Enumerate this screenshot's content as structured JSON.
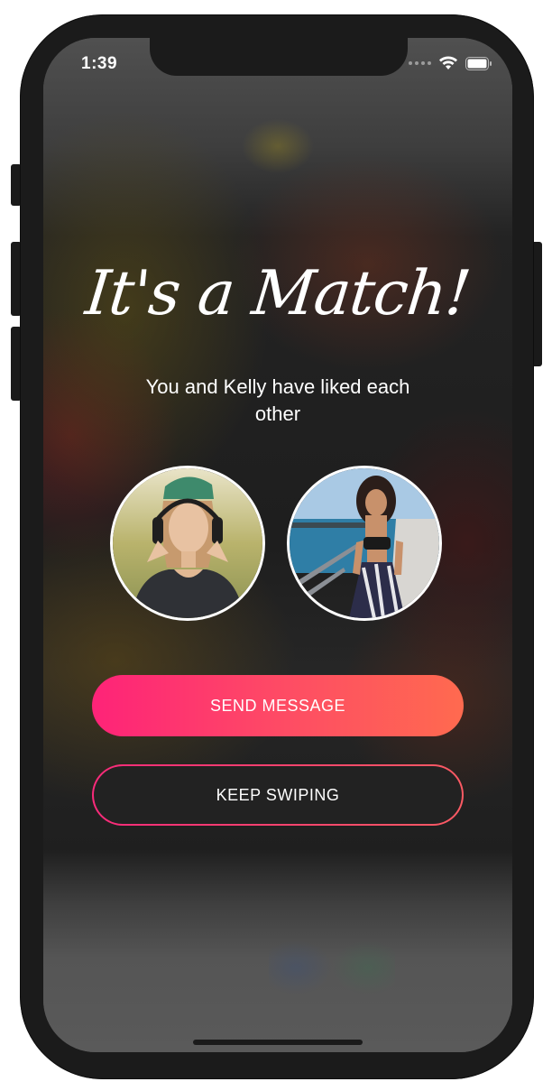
{
  "status_bar": {
    "time": "1:39"
  },
  "match": {
    "title": "It's a Match!",
    "subtitle": "You and Kelly have liked each other"
  },
  "profiles": [
    {
      "avatar_icon": "woman-with-headphones-photo"
    },
    {
      "avatar_icon": "woman-by-the-sea-photo"
    }
  ],
  "buttons": {
    "send_message": "SEND MESSAGE",
    "keep_swiping": "KEEP SWIPING"
  },
  "colors": {
    "accent_start": "#fe2378",
    "accent_end": "#ff6a4f",
    "phone_frame": "#1b1b1b"
  }
}
